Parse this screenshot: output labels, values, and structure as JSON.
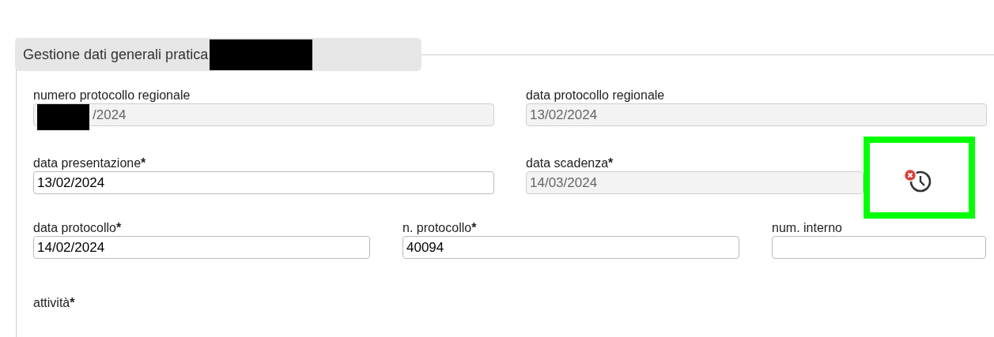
{
  "section": {
    "legend": "Gestione dati generali pratica",
    "redacted": true
  },
  "rows": [
    [
      {
        "kind": "field",
        "label": "numero protocollo regionale",
        "value": "/2024",
        "disabled": true,
        "redacted": true
      },
      {
        "kind": "field",
        "label": "data protocollo regionale",
        "value": "13/02/2024",
        "disabled": true
      }
    ],
    [
      {
        "kind": "field",
        "label": "data presentazione",
        "required_mark": "*",
        "value": "13/02/2024",
        "disabled": false
      },
      {
        "kind": "field",
        "label": "data scadenza",
        "required_mark": "*",
        "value": "14/03/2024",
        "disabled": true
      },
      {
        "kind": "icon",
        "highlighted": true
      }
    ],
    [
      {
        "kind": "field",
        "label": "data protocollo",
        "required_mark": "*",
        "value": "14/02/2024",
        "disabled": false
      },
      {
        "kind": "field",
        "label": "n. protocollo",
        "required_mark": "*",
        "value": "40094",
        "disabled": false
      },
      {
        "kind": "field",
        "label": "num. interno",
        "disabled": false
      }
    ]
  ],
  "next_label": {
    "label": "attività",
    "required_mark": "*"
  }
}
